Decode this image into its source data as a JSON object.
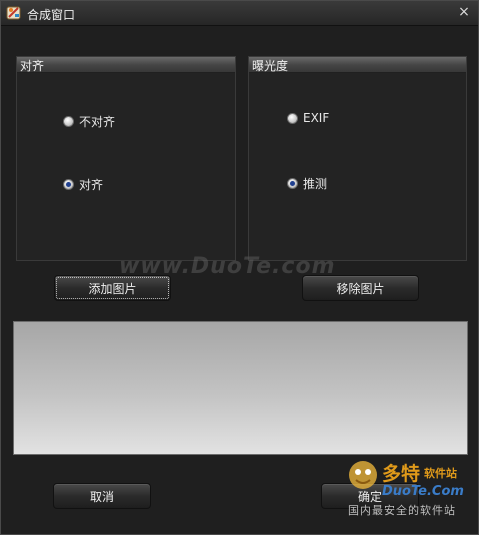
{
  "window": {
    "title": "合成窗口",
    "close_glyph": "×",
    "icon": "app-icon"
  },
  "align_group": {
    "header": "对齐",
    "options": [
      {
        "label": "不对齐",
        "checked": false
      },
      {
        "label": "对齐",
        "checked": true
      }
    ]
  },
  "exposure_group": {
    "header": "曝光度",
    "options": [
      {
        "label": "EXIF",
        "checked": false
      },
      {
        "label": "推测",
        "checked": true
      }
    ]
  },
  "buttons": {
    "add_image": "添加图片",
    "remove_image": "移除图片",
    "cancel": "取消",
    "ok": "确定"
  },
  "watermark": {
    "text": "www.DuoTe.com"
  },
  "logo": {
    "brand": "多特",
    "brand_sub": "软件站",
    "site": "DuoTe.Com",
    "slogan": "国内最安全的软件站"
  },
  "colors": {
    "accent_logo": "#e09a1a",
    "link_blue": "#3a7cc8",
    "radio_dot": "#1f3f8f"
  }
}
